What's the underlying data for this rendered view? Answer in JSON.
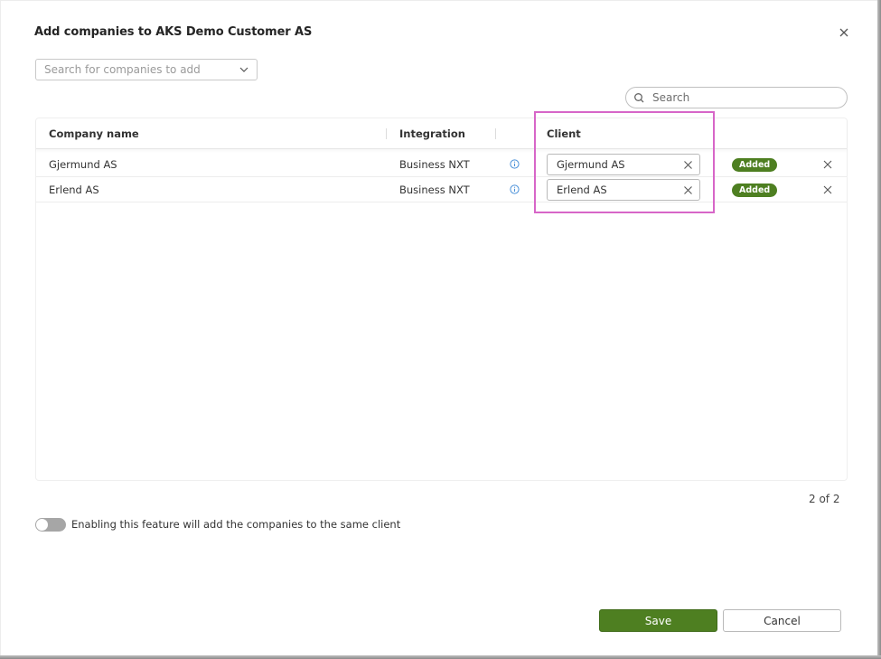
{
  "dialog": {
    "title": "Add companies to AKS Demo Customer AS",
    "close_icon": "close-icon"
  },
  "company_select": {
    "placeholder": "Search for companies to add",
    "icon": "chevron-down-icon"
  },
  "search": {
    "placeholder": "Search",
    "value": "",
    "icon": "search-icon"
  },
  "table": {
    "columns": [
      "Company name",
      "Integration",
      "",
      "Client",
      "",
      ""
    ],
    "rows": [
      {
        "company_name": "Gjermund AS",
        "integration": "Business NXT",
        "info_icon": "info-icon",
        "client": "Gjermund AS",
        "status": "Added"
      },
      {
        "company_name": "Erlend AS",
        "integration": "Business NXT",
        "info_icon": "info-icon",
        "client": "Erlend AS",
        "status": "Added"
      }
    ],
    "pagination": "2 of 2"
  },
  "same_client_toggle": {
    "enabled": false,
    "label": "Enabling this feature will add the companies to the same client"
  },
  "footer": {
    "save_label": "Save",
    "cancel_label": "Cancel"
  },
  "colors": {
    "primary_green": "#4e7f21",
    "highlight_magenta": "#d766c8",
    "info_blue": "#4a90d9"
  }
}
